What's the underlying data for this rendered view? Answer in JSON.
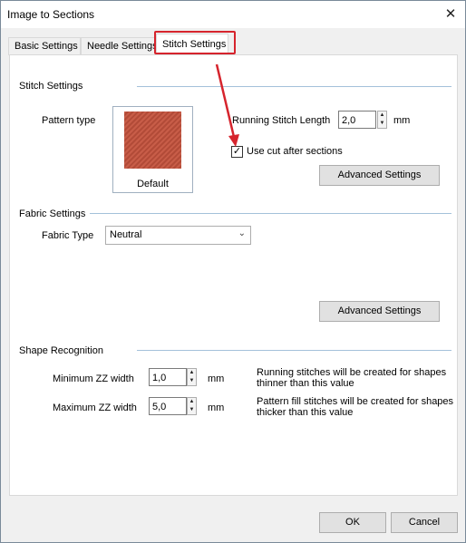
{
  "window": {
    "title": "Image to Sections",
    "close_glyph": "✕"
  },
  "tabs": [
    {
      "label": "Basic Settings"
    },
    {
      "label": "Needle Settings"
    },
    {
      "label": "Stitch Settings"
    }
  ],
  "stitch": {
    "section_title": "Stitch Settings",
    "pattern_label": "Pattern type",
    "pattern_caption": "Default",
    "running_label": "Running Stitch Length",
    "running_value": "2,0",
    "running_unit": "mm",
    "use_cut_label": "Use cut after sections",
    "use_cut_checked": true,
    "advanced_label": "Advanced Settings"
  },
  "fabric": {
    "section_title": "Fabric Settings",
    "type_label": "Fabric Type",
    "type_value": "Neutral",
    "advanced_label": "Advanced Settings"
  },
  "shape": {
    "section_title": "Shape Recognition",
    "min_label": "Minimum ZZ width",
    "min_value": "1,0",
    "min_unit": "mm",
    "min_desc_1": "Running stitches will be created for shapes",
    "min_desc_2": "thinner than this value",
    "max_label": "Maximum ZZ width",
    "max_value": "5,0",
    "max_unit": "mm",
    "max_desc_1": "Pattern fill stitches will be created for shapes",
    "max_desc_2": "thicker than this value"
  },
  "footer": {
    "ok_label": "OK",
    "cancel_label": "Cancel"
  },
  "colors": {
    "highlight": "#d6242d",
    "accent_line": "#a4c1da"
  },
  "icons": {
    "spin_up": "up-arrow-icon",
    "spin_down": "down-arrow-icon",
    "combo": "chevron-down-icon",
    "checkbox": "check-icon"
  }
}
